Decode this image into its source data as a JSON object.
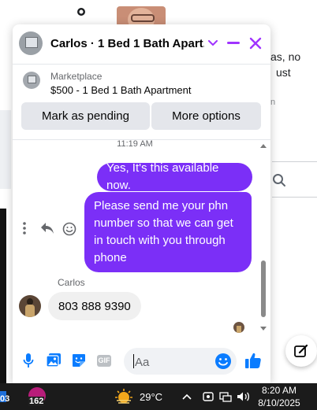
{
  "background": {
    "snippets": [
      "as, no",
      "ust"
    ],
    "small_snippet": "n"
  },
  "chat": {
    "title": "Carlos · 1 Bed 1 Bath Apart...",
    "accent": "#a033ff",
    "listing": {
      "label": "Marketplace",
      "item": "$500 - 1 Bed 1 Bath Apartment",
      "buttons": [
        "Mark as pending",
        "More options"
      ]
    },
    "timestamp": "11:19 AM",
    "messages_out": [
      "Yes, It's this available now.",
      "Please send me your phn number so that we can get in touch with you through phone"
    ],
    "sender_name": "Carlos",
    "message_in": "803 888 9390",
    "outgoing_color": "#7b2ff7",
    "composer": {
      "placeholder": "Aa"
    }
  },
  "taskbar": {
    "left_number": "03",
    "app_badge": "162",
    "temperature": "29°C",
    "time": "8:20 AM",
    "date": "8/10/2025"
  }
}
